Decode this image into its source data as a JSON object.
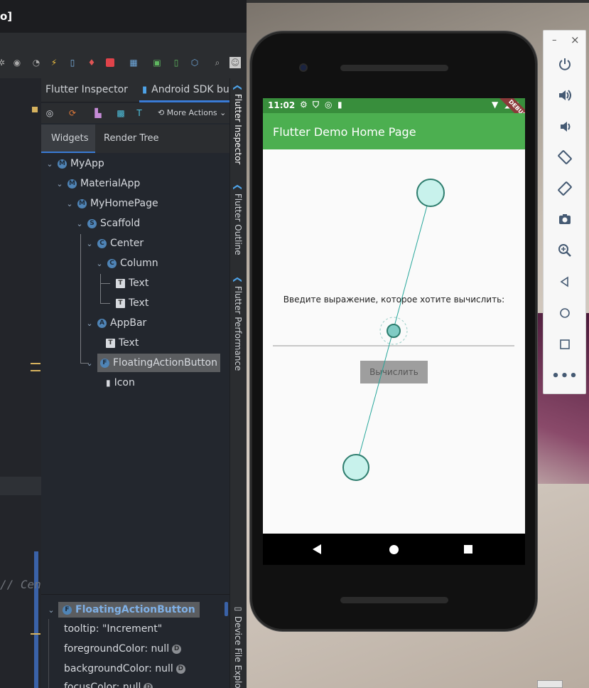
{
  "ide": {
    "title_fragment": "o]",
    "tabs": [
      "Flutter Inspector",
      "Android SDK bu"
    ],
    "more_actions": "More Actions",
    "subtabs": [
      "Widgets",
      "Render Tree"
    ],
    "tree": [
      {
        "label": "MyApp",
        "badge": "M"
      },
      {
        "label": "MaterialApp",
        "badge": "M"
      },
      {
        "label": "MyHomePage",
        "badge": "M"
      },
      {
        "label": "Scaffold",
        "badge": "S"
      },
      {
        "label": "Center",
        "badge": "C"
      },
      {
        "label": "Column",
        "badge": "C"
      },
      {
        "label": "Text",
        "badge": "T"
      },
      {
        "label": "Text",
        "badge": "T"
      },
      {
        "label": "AppBar",
        "badge": "A"
      },
      {
        "label": "Text",
        "badge": "T"
      },
      {
        "label": "FloatingActionButton",
        "badge": "F"
      },
      {
        "label": "Icon",
        "badge": ""
      }
    ],
    "side_tabs": [
      "Flutter Inspector",
      "Flutter Outline",
      "Flutter Performance",
      "Device File Explo"
    ],
    "editor_comment": "// Cente",
    "properties": {
      "header": "FloatingActionButton",
      "header_badge": "F",
      "items": [
        "tooltip: \"Increment\"",
        "foregroundColor: null",
        "backgroundColor: null",
        "focusColor: null"
      ],
      "default_badge": "D"
    }
  },
  "phone": {
    "time": "11:02",
    "debug_banner": "DEBUG",
    "app_title": "Flutter Demo Home Page",
    "prompt": "Введите выражение, которое хотите вычислить:",
    "button_label": "Вычислить"
  },
  "emulator_panel": {
    "minimize": "–",
    "close": "×",
    "buttons": [
      "power-icon",
      "volume-up-icon",
      "volume-down-icon",
      "rotate-left-icon",
      "rotate-right-icon",
      "camera-icon",
      "zoom-icon",
      "back-icon",
      "home-icon",
      "overview-icon",
      "more-icon"
    ]
  },
  "colors": {
    "app_bar": "#4caf50",
    "status_bar": "#388e3c",
    "selection": "#5b5d60",
    "touch_line": "#26a69a"
  }
}
